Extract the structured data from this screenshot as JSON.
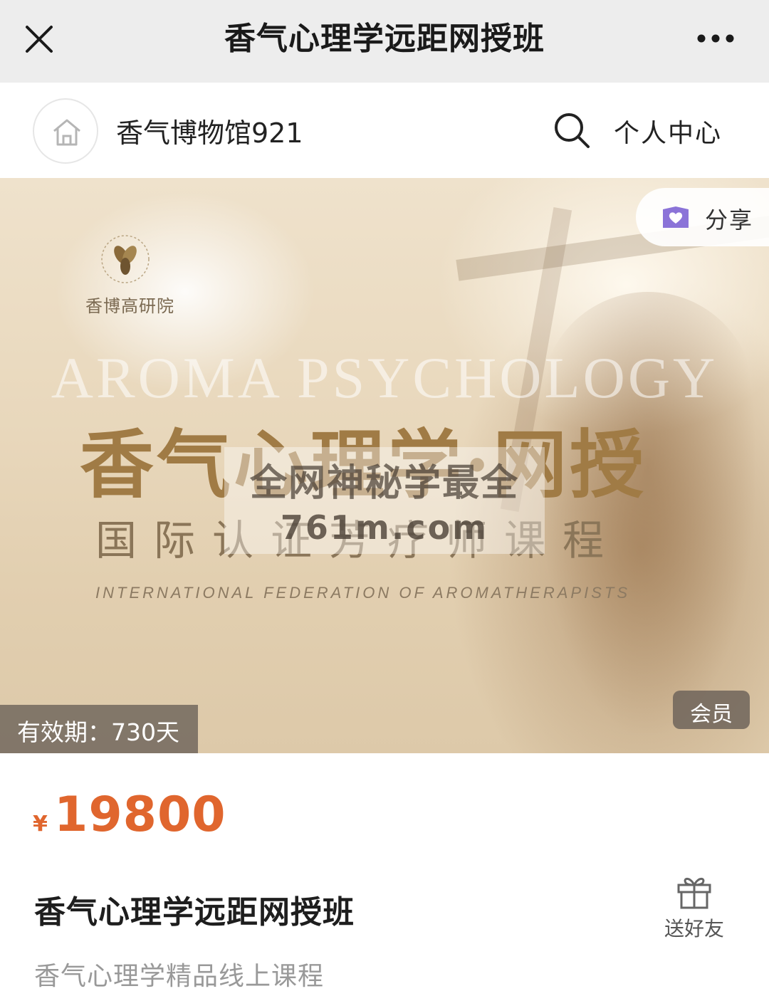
{
  "titlebar": {
    "title": "香气心理学远距网授班",
    "close_icon": "close-icon",
    "more_icon": "more-dots-icon"
  },
  "store": {
    "home_icon": "home-icon",
    "name": "香气博物馆921",
    "search_icon": "search-icon",
    "profile_label": "个人中心"
  },
  "banner": {
    "logo_text": "香博高研院",
    "en_title": "AROMA PSYCHOLOGY",
    "cn_title": "香气心理学·网授",
    "cn_subtitle": "国际认证芳疗师课程",
    "en_subtitle": "INTERNATIONAL FEDERATION OF AROMATHERAPISTS",
    "share_label": "分享",
    "share_icon": "share-heart-icon",
    "watermark_line1": "全网神秘学最全",
    "watermark_line2": "761m.com",
    "validity": "有效期：730天",
    "member_badge": "会员",
    "colors": {
      "gold_title": "#a07b45",
      "badge_bg": "#6e645a"
    }
  },
  "product": {
    "currency": "¥",
    "price": "19800",
    "title": "香气心理学远距网授班",
    "description": "香气心理学精品线上课程",
    "gift_label": "送好友",
    "gift_icon": "gift-icon",
    "price_color": "#e0662e"
  }
}
